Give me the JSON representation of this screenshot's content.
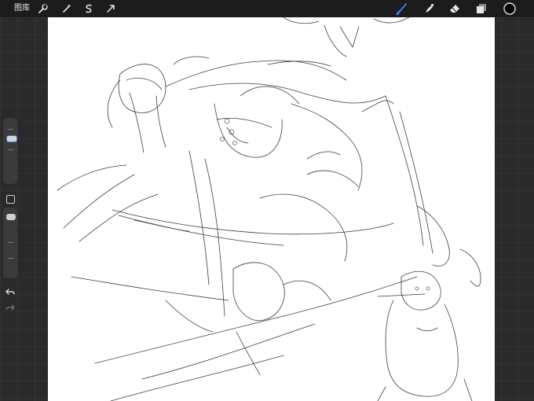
{
  "topbar": {
    "gallery_label": "图库",
    "left_tools": [
      "wrench-icon",
      "magic-wand-icon",
      "selection-icon",
      "transform-arrow-icon"
    ],
    "right_tools": [
      "brush-icon",
      "smudge-icon",
      "eraser-icon",
      "layers-icon",
      "color-swatch"
    ],
    "active_tool": "brush-icon",
    "accent_color": "#2f7bf2",
    "current_color": "#000000"
  },
  "sidebar": {
    "controls": [
      "brush-size-slider",
      "modify-button",
      "opacity-slider",
      "undo-icon",
      "redo-icon"
    ]
  },
  "canvas": {
    "background": "#ffffff",
    "stroke_color": "#222222"
  }
}
